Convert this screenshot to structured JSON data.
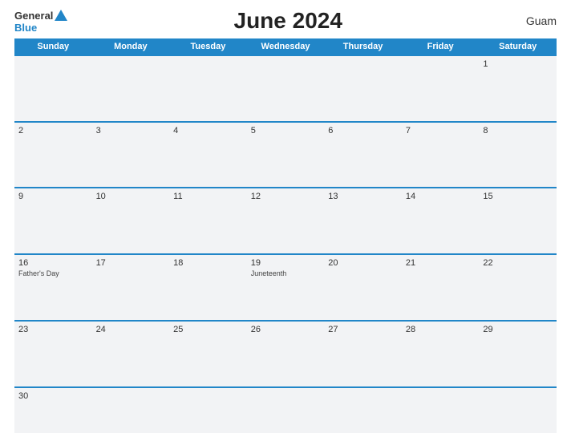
{
  "header": {
    "title": "June 2024",
    "region": "Guam",
    "logo_general": "General",
    "logo_blue": "Blue"
  },
  "days": {
    "headers": [
      "Sunday",
      "Monday",
      "Tuesday",
      "Wednesday",
      "Thursday",
      "Friday",
      "Saturday"
    ]
  },
  "weeks": [
    {
      "cells": [
        {
          "date": "",
          "empty": true
        },
        {
          "date": "",
          "empty": true
        },
        {
          "date": "",
          "empty": true
        },
        {
          "date": "",
          "empty": true
        },
        {
          "date": "",
          "empty": true
        },
        {
          "date": "",
          "empty": true
        },
        {
          "date": "1",
          "event": ""
        }
      ]
    },
    {
      "cells": [
        {
          "date": "2",
          "event": ""
        },
        {
          "date": "3",
          "event": ""
        },
        {
          "date": "4",
          "event": ""
        },
        {
          "date": "5",
          "event": ""
        },
        {
          "date": "6",
          "event": ""
        },
        {
          "date": "7",
          "event": ""
        },
        {
          "date": "8",
          "event": ""
        }
      ]
    },
    {
      "cells": [
        {
          "date": "9",
          "event": ""
        },
        {
          "date": "10",
          "event": ""
        },
        {
          "date": "11",
          "event": ""
        },
        {
          "date": "12",
          "event": ""
        },
        {
          "date": "13",
          "event": ""
        },
        {
          "date": "14",
          "event": ""
        },
        {
          "date": "15",
          "event": ""
        }
      ]
    },
    {
      "cells": [
        {
          "date": "16",
          "event": "Father's Day"
        },
        {
          "date": "17",
          "event": ""
        },
        {
          "date": "18",
          "event": ""
        },
        {
          "date": "19",
          "event": "Juneteenth"
        },
        {
          "date": "20",
          "event": ""
        },
        {
          "date": "21",
          "event": ""
        },
        {
          "date": "22",
          "event": ""
        }
      ]
    },
    {
      "cells": [
        {
          "date": "23",
          "event": ""
        },
        {
          "date": "24",
          "event": ""
        },
        {
          "date": "25",
          "event": ""
        },
        {
          "date": "26",
          "event": ""
        },
        {
          "date": "27",
          "event": ""
        },
        {
          "date": "28",
          "event": ""
        },
        {
          "date": "29",
          "event": ""
        }
      ]
    },
    {
      "cells": [
        {
          "date": "30",
          "event": ""
        },
        {
          "date": "",
          "empty": true
        },
        {
          "date": "",
          "empty": true
        },
        {
          "date": "",
          "empty": true
        },
        {
          "date": "",
          "empty": true
        },
        {
          "date": "",
          "empty": true
        },
        {
          "date": "",
          "empty": true
        }
      ]
    }
  ]
}
